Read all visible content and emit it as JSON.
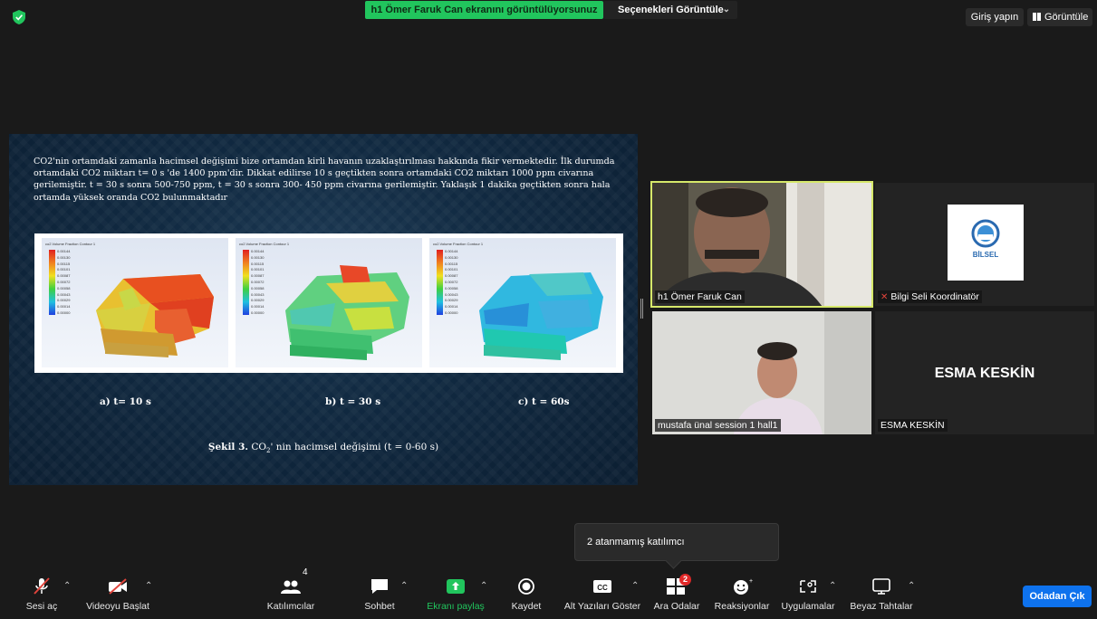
{
  "topbar": {
    "share_banner": "h1 Ömer Faruk Can ekranını görüntülüyorsunuz",
    "view_options": "Seçenekleri Görüntüle",
    "sign_in": "Giriş yapın",
    "view": "Görüntüle"
  },
  "slide": {
    "paragraph": "CO2'nin ortamdaki zamanla hacimsel değişimi bize ortamdan kirli havanın uzaklaştırılması hakkında fikir vermektedir. İlk durumda ortamdaki CO2 miktarı t= 0 s 'de 1400 ppm'dir. Dikkat edilirse 10 s geçtikten sonra ortamdaki CO2 miktarı 1000 ppm civarına gerilemiştir. t = 30 s sonra 500-750 ppm, t = 30 s sonra 300- 450 ppm civarına gerilemiştir. Yaklaşık 1 dakika geçtikten sonra hala ortamda yüksek oranda CO2 bulunmaktadır",
    "captions": [
      "a) t= 10 s",
      "b) t = 30 s",
      "c) t = 60s"
    ],
    "figure_caption_bold": "Şekil 3.",
    "figure_caption_pre": " CO",
    "figure_caption_sub": "2",
    "figure_caption_post": "' nin hacimsel değişimi (t = 0-60 s)",
    "legend_title": "co2.Volume Fraction Contour 1",
    "legend_values": [
      "0.00144",
      "0.00130",
      "0.00115",
      "0.00101",
      "0.00087",
      "0.00072",
      "0.00058",
      "0.00043",
      "0.00029",
      "0.00014",
      "0.00000"
    ]
  },
  "participants": [
    {
      "name": "h1 Ömer Faruk Can"
    },
    {
      "name": "Bilgi Seli Koordinatör",
      "logo_text": "BİLSEL"
    },
    {
      "name": "mustafa ünal session 1 hall1"
    },
    {
      "name": "ESMA KESKİN",
      "display": "ESMA KESKİN"
    }
  ],
  "popup": "2 atanmamış katılımcı",
  "toolbar": {
    "audio": "Sesi aç",
    "video": "Videoyu Başlat",
    "participants": "Katılımcılar",
    "participants_count": "4",
    "chat": "Sohbet",
    "share": "Ekranı paylaş",
    "record": "Kaydet",
    "captions": "Alt Yazıları Göster",
    "captions_icon": "CC",
    "breakout": "Ara Odalar",
    "breakout_badge": "2",
    "reactions": "Reaksiyonlar",
    "apps": "Uygulamalar",
    "whiteboards": "Beyaz Tahtalar",
    "leave": "Odadan Çık"
  },
  "colors": {
    "share_banner": "#21c55d",
    "active_speaker": "#d6e86a",
    "leave": "#0e72ed",
    "muted": "#e0443c"
  }
}
